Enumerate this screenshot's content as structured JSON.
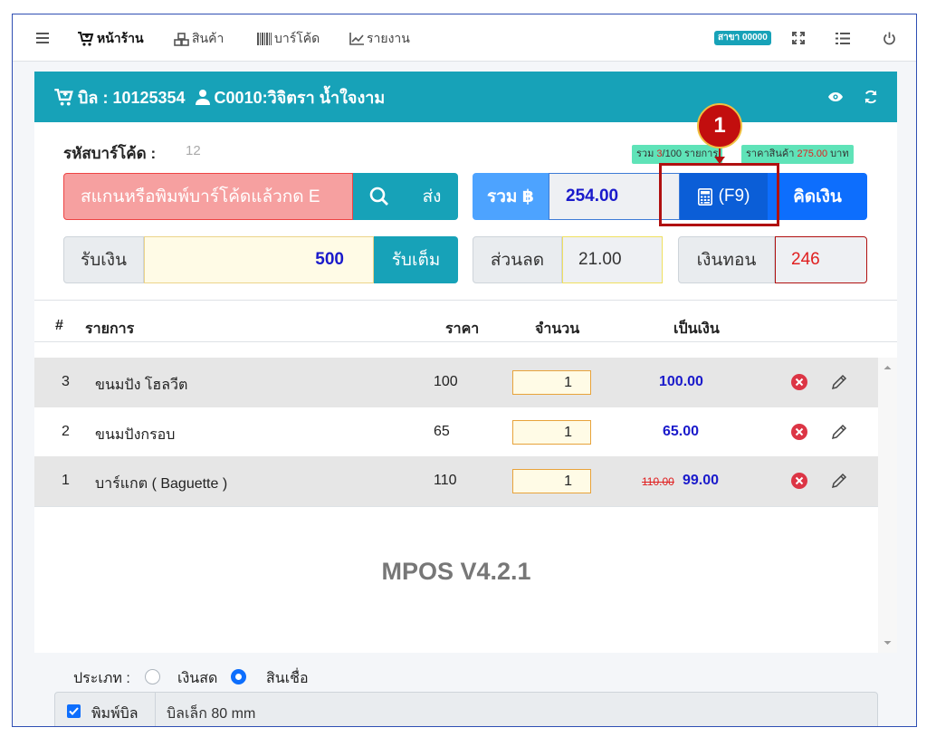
{
  "nav": {
    "items": [
      {
        "label": "หน้าร้าน",
        "icon": "cart-plus-icon",
        "active": true
      },
      {
        "label": "สินค้า",
        "icon": "cubes-icon"
      },
      {
        "label": "บาร์โค้ด",
        "icon": "barcode-icon"
      },
      {
        "label": "รายงาน",
        "icon": "chart-line-icon"
      }
    ],
    "branch_badge": "สาขา 00000",
    "right_icons": [
      "expand-icon",
      "list-icon",
      "power-icon"
    ]
  },
  "bill": {
    "bill_label": "บิล : 10125354",
    "customer": "C0010:วิจิตรา น้ำใจงาม",
    "header_icons": [
      "eye-icon",
      "refresh-icon"
    ]
  },
  "barcode": {
    "label": "รหัสบาร์โค้ด :",
    "count": "12",
    "placeholder": "สแกนหรือพิมพ์บาร์โค้ดแล้วกด E",
    "send_label": "ส่ง"
  },
  "summary": {
    "items_prefix": "รวม ",
    "items_count": "3",
    "items_suffix": "/100 รายการ",
    "price_prefix": "ราคาสินค้า ",
    "price_value": "275.00",
    "price_suffix": " บาท",
    "total_label": "รวม ฿",
    "total_value": "254.00",
    "calc_label": "(F9)",
    "checkout_label": "คิดเงิน"
  },
  "payment": {
    "receive_label": "รับเงิน",
    "receive_value": "500",
    "full_label": "รับเต็ม",
    "discount_label": "ส่วนลด",
    "discount_value": "21.00",
    "change_label": "เงินทอน",
    "change_value": "246"
  },
  "callout": {
    "number": "1"
  },
  "table": {
    "headers": {
      "index": "#",
      "item": "รายการ",
      "price": "ราคา",
      "qty": "จำนวน",
      "amount": "เป็นเงิน"
    },
    "rows": [
      {
        "no": "3",
        "name": "ขนมปัง โฮลวีต",
        "price": "100",
        "qty": "1",
        "old_amount": "",
        "amount": "100.00"
      },
      {
        "no": "2",
        "name": "ขนมปังกรอบ",
        "price": "65",
        "qty": "1",
        "old_amount": "",
        "amount": "65.00"
      },
      {
        "no": "1",
        "name": "บาร์แกต ( Baguette )",
        "price": "110",
        "qty": "1",
        "old_amount": "110.00",
        "amount": "99.00"
      }
    ]
  },
  "watermark": "MPOS V4.2.1",
  "footer": {
    "type_label": "ประเภท :",
    "cash_label": "เงินสด",
    "credit_label": "สินเชื่อ",
    "selected": "credit",
    "print_label": "พิมพ์บิล",
    "print_checked": true,
    "paper_value": "บิลเล็ก 80 mm"
  },
  "colors": {
    "header_teal": "#17a2b8",
    "primary_blue": "#0d6efd",
    "total_blue": "#4da3ff",
    "amount_blue": "#1a1acb",
    "danger_red": "#e02020",
    "highlight_red": "#b01010",
    "pill_green": "#5fe3b8"
  }
}
